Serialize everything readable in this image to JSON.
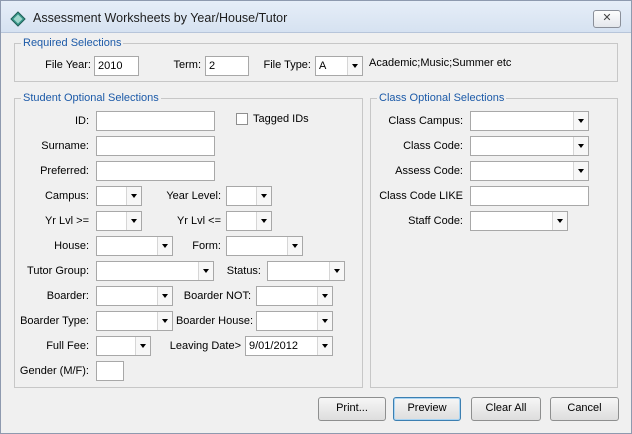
{
  "window": {
    "title": "Assessment Worksheets by Year/House/Tutor",
    "close_label": "✕"
  },
  "required": {
    "legend": "Required Selections",
    "file_year_label": "File Year:",
    "file_year_value": "2010",
    "term_label": "Term:",
    "term_value": "2",
    "file_type_label": "File Type:",
    "file_type_value": "A",
    "file_type_hint": "Academic;Music;Summer etc"
  },
  "student": {
    "legend": "Student Optional Selections",
    "id_label": "ID:",
    "tagged_ids_label": "Tagged IDs",
    "surname_label": "Surname:",
    "preferred_label": "Preferred:",
    "campus_label": "Campus:",
    "year_level_label": "Year Level:",
    "yr_lvl_gte_label": "Yr Lvl >=",
    "yr_lvl_lte_label": "Yr Lvl <=",
    "house_label": "House:",
    "form_label": "Form:",
    "tutor_group_label": "Tutor Group:",
    "status_label": "Status:",
    "boarder_label": "Boarder:",
    "boarder_not_label": "Boarder NOT:",
    "boarder_type_label": "Boarder Type:",
    "boarder_house_label": "Boarder House:",
    "full_fee_label": "Full Fee:",
    "leaving_date_label": "Leaving Date>",
    "leaving_date_value": "9/01/2012",
    "gender_label": "Gender (M/F):"
  },
  "class": {
    "legend": "Class Optional Selections",
    "class_campus_label": "Class Campus:",
    "class_code_label": "Class Code:",
    "assess_code_label": "Assess Code:",
    "class_code_like_label": "Class Code LIKE",
    "staff_code_label": "Staff Code:"
  },
  "buttons": {
    "print": "Print...",
    "preview": "Preview",
    "clear_all": "Clear All",
    "cancel": "Cancel"
  },
  "icons": {
    "app": "diamond-app-icon",
    "close": "close-icon",
    "dropdown": "chevron-down-icon"
  },
  "colors": {
    "legend_text": "#1c5aa8",
    "window_bg": "#f0f0f0",
    "title_gradient_top": "#e6eef8"
  }
}
